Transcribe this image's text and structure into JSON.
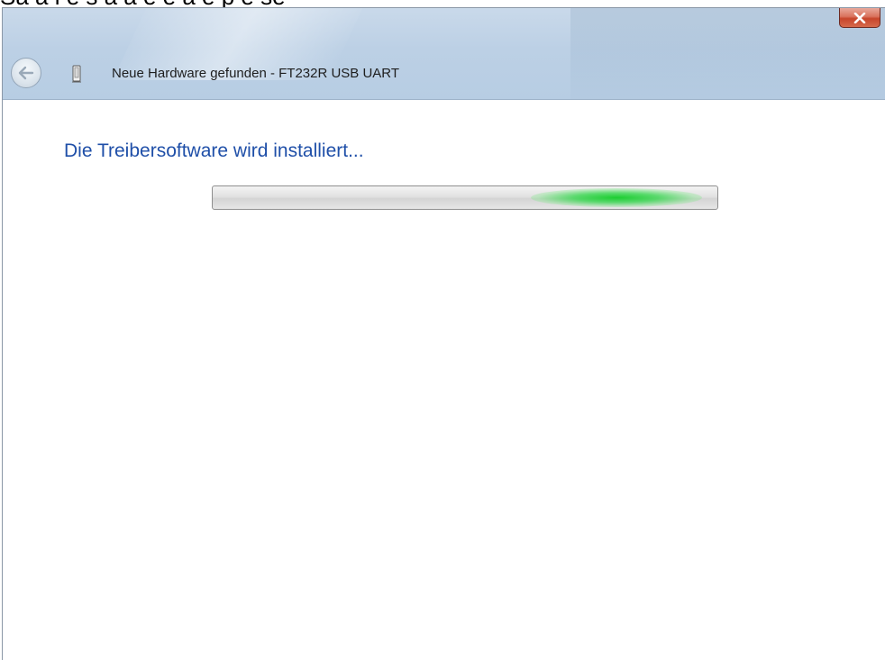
{
  "caption": {
    "text": "Sa a l e s a a e e a e p e se"
  },
  "window": {
    "title": "Neue Hardware gefunden - FT232R USB UART",
    "close_icon": "close-icon",
    "back_icon": "back-arrow-icon",
    "device_icon": "usb-device-icon"
  },
  "main": {
    "heading": "Die Treibersoftware wird installiert...",
    "progress": {
      "mode": "indeterminate",
      "glow_position": 0.8,
      "glow_color": "#1ccf3a"
    }
  },
  "colors": {
    "heading": "#1f4fa8",
    "titlebar": "#bcd0e5",
    "close_button": "#c7452b"
  }
}
